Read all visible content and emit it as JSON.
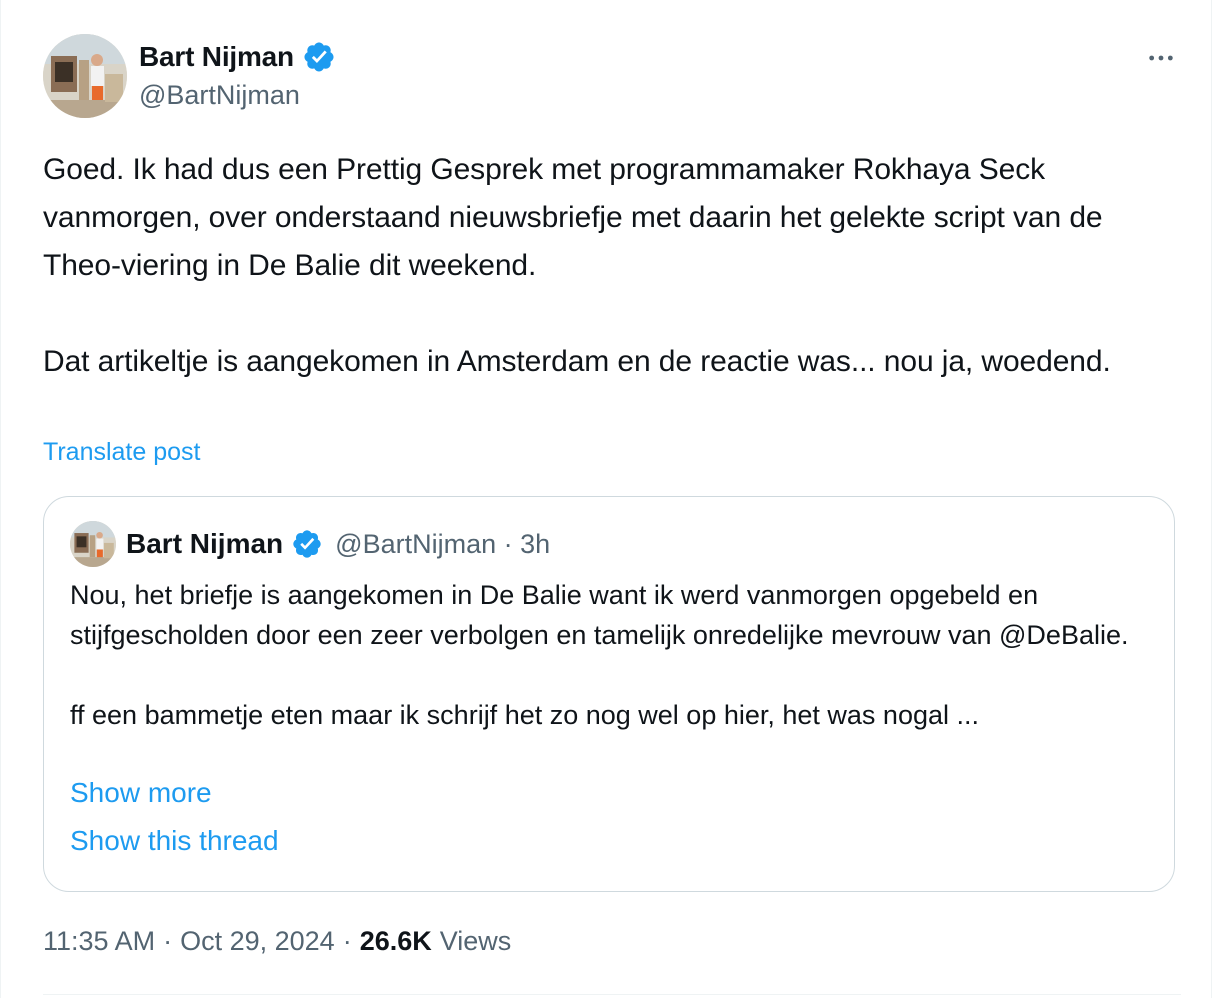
{
  "author": {
    "name": "Bart Nijman",
    "handle": "@BartNijman",
    "verified": true,
    "avatar_icon": "avatar-photo"
  },
  "tweet": {
    "text": "Goed. Ik had dus een Prettig Gesprek met programmamaker Rokhaya Seck vanmorgen, over onderstaand nieuwsbriefje met daarin het gelekte script van de Theo-viering in De Balie dit weekend.\n\nDat artikeltje is aangekomen in Amsterdam en de reactie was... nou ja, woedend.",
    "translate_label": "Translate post"
  },
  "quoted": {
    "name": "Bart Nijman",
    "handle": "@BartNijman",
    "separator": "·",
    "time_ago": "3h",
    "text": "Nou, het briefje is aangekomen in De Balie want ik werd vanmorgen opgebeld en stijfgescholden door een zeer verbolgen en tamelijk onredelijke mevrouw van @DeBalie.\n\nff een bammetje eten maar ik schrijf het zo nog wel op hier, het was nogal ...",
    "show_more_label": "Show more",
    "show_thread_label": "Show this thread"
  },
  "footer": {
    "time": "11:35 AM",
    "separator": "·",
    "date": "Oct 29, 2024",
    "views_count": "26.6K",
    "views_label": "Views"
  },
  "colors": {
    "accent": "#1d9bf0",
    "text": "#0f1419",
    "secondary": "#536471",
    "border": "#cfd9de"
  },
  "icons": {
    "more": "more-horizontal-icon",
    "verified": "verified-badge-icon"
  }
}
